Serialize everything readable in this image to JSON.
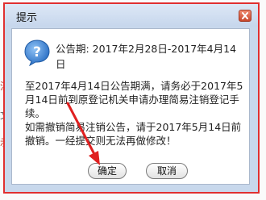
{
  "background": {
    "fragments": [
      "注书",
      "文件",
      "示"
    ]
  },
  "dialog": {
    "title": "提示",
    "period_label": "公告期: 2017年2月28日-2017年4月14日",
    "message_lines": [
      "至2017年4月14日公告期满，请务必于2017年5月14日前到原登记机关申请办理简易注销登记手续。",
      "如需撤销简易注销公告，请于2017年5月14日前撤销。一经提交则无法再做修改！"
    ],
    "ok_label": "确定",
    "cancel_label": "取消"
  },
  "colors": {
    "highlight_border": "#e03030",
    "annotation_arrow": "#e02020"
  },
  "icons": {
    "info": "question-icon",
    "close": "close-icon"
  }
}
